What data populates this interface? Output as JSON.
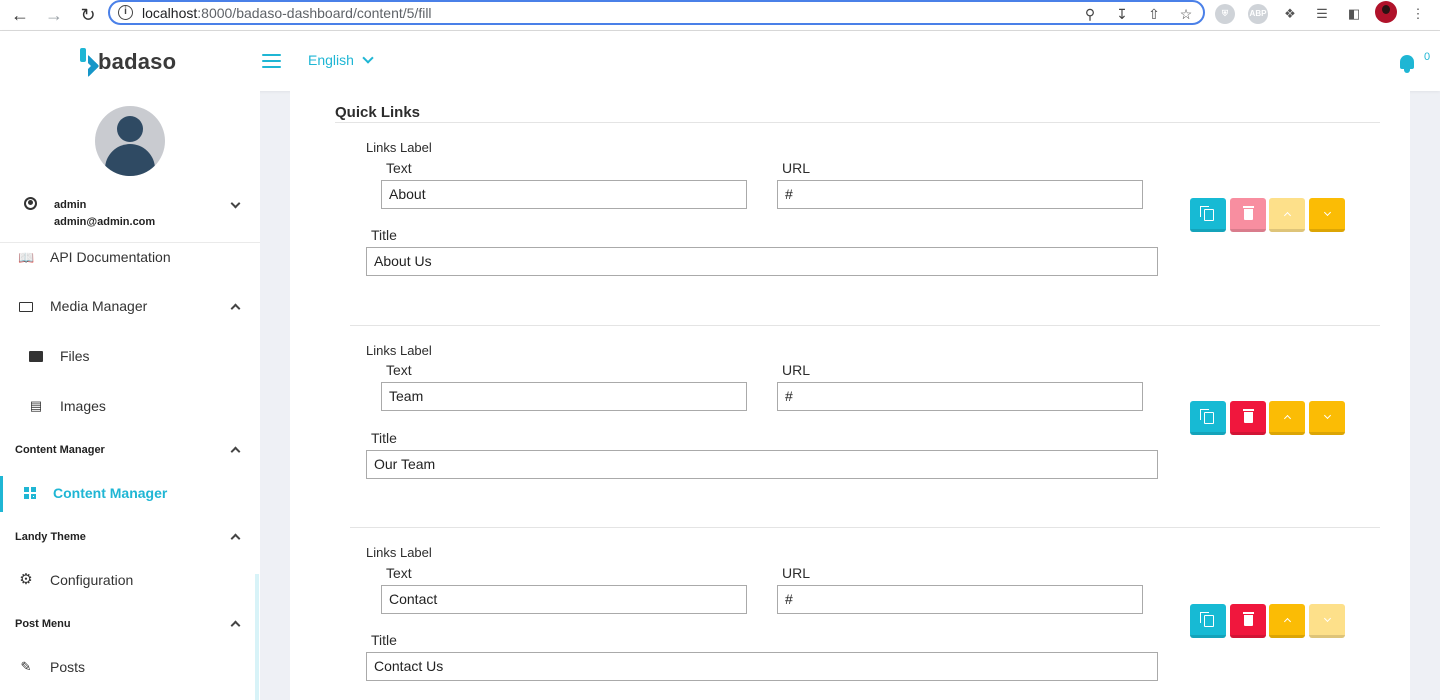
{
  "browser": {
    "url_host": "localhost",
    "url_path": ":8000/badaso-dashboard/content/5/fill"
  },
  "header": {
    "logo_text": "badaso",
    "language": "English",
    "notification_count": "0"
  },
  "user": {
    "name": "admin",
    "email": "admin@admin.com"
  },
  "sidebar": {
    "api_doc": "API Documentation",
    "media_manager": "Media Manager",
    "files": "Files",
    "images": "Images",
    "content_manager_section": "Content Manager",
    "content_manager_item": "Content Manager",
    "landy_theme_section": "Landy Theme",
    "configuration": "Configuration",
    "post_menu_section": "Post Menu",
    "posts": "Posts"
  },
  "main": {
    "section_title": "Quick Links",
    "group_label": "Links Label",
    "text_label": "Text",
    "url_label": "URL",
    "title_label": "Title",
    "items": [
      {
        "text": "About",
        "url": "#",
        "title": "About Us",
        "delete_disabled": true,
        "up_disabled": true,
        "down_disabled": false
      },
      {
        "text": "Team",
        "url": "#",
        "title": "Our Team",
        "delete_disabled": false,
        "up_disabled": false,
        "down_disabled": false
      },
      {
        "text": "Contact",
        "url": "#",
        "title": "Contact Us",
        "delete_disabled": false,
        "up_disabled": false,
        "down_disabled": true
      }
    ]
  },
  "colors": {
    "accent": "#1fb6d4",
    "danger": "#f0173d",
    "warning": "#fbbc05"
  }
}
